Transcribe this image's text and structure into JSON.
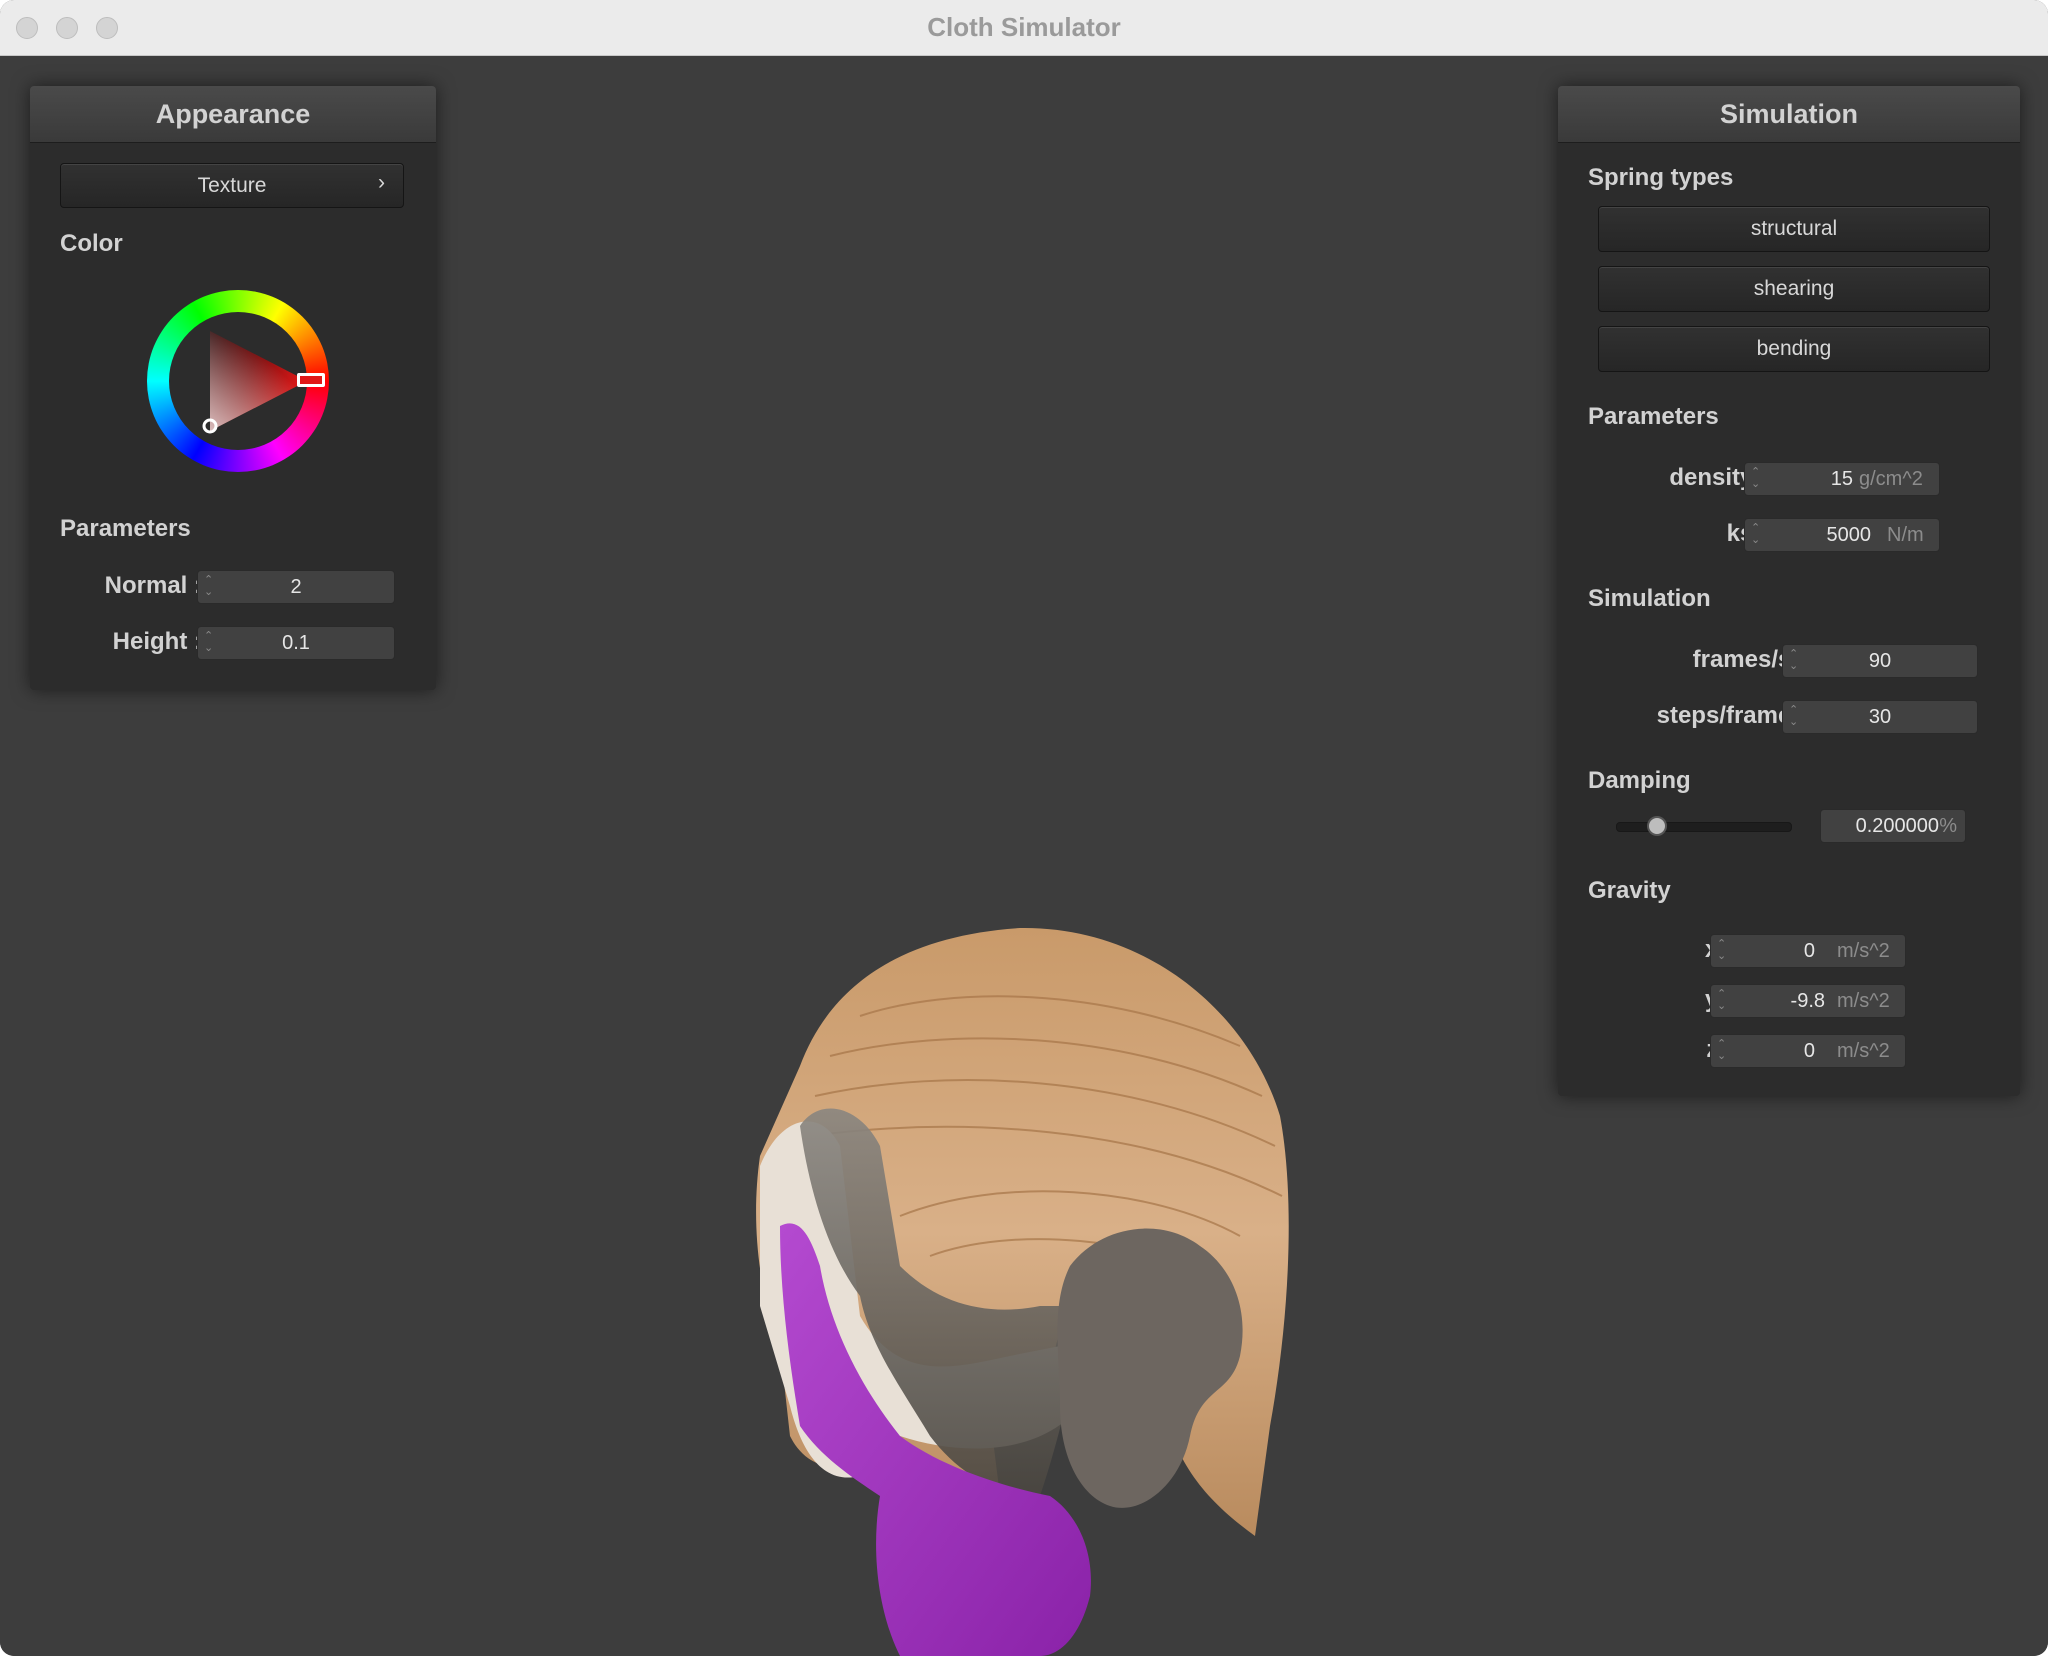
{
  "window": {
    "title": "Cloth Simulator"
  },
  "appearance": {
    "title": "Appearance",
    "texture_label": "Texture",
    "texture_chevron": "›",
    "color_label": "Color",
    "selected_color": "#e01818",
    "parameters_label": "Parameters",
    "normal_label": "Normal :",
    "normal_value": "2",
    "height_label": "Height :",
    "height_value": "0.1"
  },
  "simulation": {
    "title": "Simulation",
    "spring_types_label": "Spring types",
    "spring_buttons": [
      "structural",
      "shearing",
      "bending"
    ],
    "parameters_label": "Parameters",
    "density_label": "density :",
    "density_value": "15",
    "density_unit": "g/cm^2",
    "ks_label": "ks :",
    "ks_value": "5000",
    "ks_unit": "N/m",
    "simulation_label": "Simulation",
    "fps_label": "frames/s :",
    "fps_value": "90",
    "steps_label": "steps/frame :",
    "steps_value": "30",
    "damping_label": "Damping",
    "damping_value": "0.200000",
    "damping_unit": "%",
    "damping_slider_fraction": 0.2,
    "gravity_label": "Gravity",
    "gx_label": "x :",
    "gx_value": "0",
    "gy_label": "y :",
    "gy_value": "-9.8",
    "gz_label": "z :",
    "gz_value": "0",
    "gravity_unit": "m/s^2"
  }
}
